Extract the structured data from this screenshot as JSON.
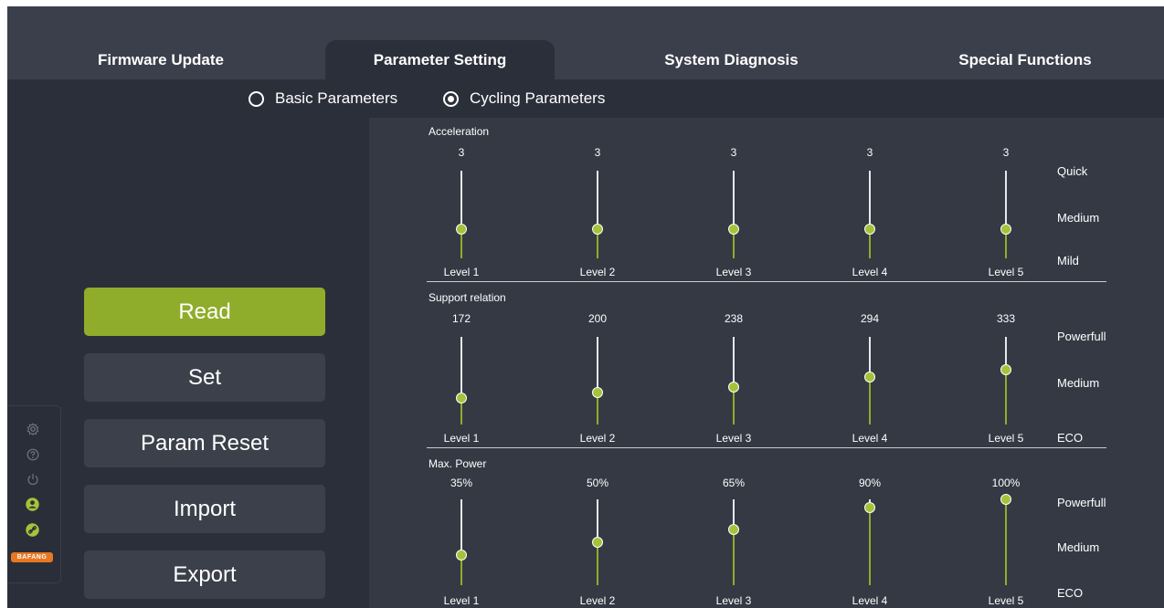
{
  "tabs": [
    {
      "label": "Firmware Update",
      "active": false
    },
    {
      "label": "Parameter Setting",
      "active": true
    },
    {
      "label": "System Diagnosis",
      "active": false
    },
    {
      "label": "Special Functions",
      "active": false
    }
  ],
  "radios": [
    {
      "label": "Basic Parameters",
      "checked": false
    },
    {
      "label": "Cycling Parameters",
      "checked": true
    }
  ],
  "buttons": {
    "read": "Read",
    "set": "Set",
    "param_reset": "Param Reset",
    "import": "Import",
    "export": "Export"
  },
  "sidebar_icons": [
    "gear-icon",
    "help-icon",
    "power-icon",
    "user-icon",
    "link-icon"
  ],
  "logo": {
    "text": "BAFANG"
  },
  "colors": {
    "accent": "#8fad2a",
    "thumb": "#a6c23a",
    "panel": "#2b2f39",
    "background": "#353944"
  },
  "sections": [
    {
      "title": "Acceleration",
      "sliders": [
        {
          "value": "3",
          "label": "Level 1",
          "level": 0.33
        },
        {
          "value": "3",
          "label": "Level 2",
          "level": 0.33
        },
        {
          "value": "3",
          "label": "Level 3",
          "level": 0.33
        },
        {
          "value": "3",
          "label": "Level 4",
          "level": 0.33
        },
        {
          "value": "3",
          "label": "Level 5",
          "level": 0.33
        }
      ],
      "scale": [
        "Quick",
        "Medium",
        "Mild"
      ]
    },
    {
      "title": "Support relation",
      "sliders": [
        {
          "value": "172",
          "label": "Level 1",
          "level": 0.3
        },
        {
          "value": "200",
          "label": "Level 2",
          "level": 0.36
        },
        {
          "value": "238",
          "label": "Level 3",
          "level": 0.43
        },
        {
          "value": "294",
          "label": "Level 4",
          "level": 0.54
        },
        {
          "value": "333",
          "label": "Level 5",
          "level": 0.62
        }
      ],
      "scale": [
        "Powerfull",
        "Medium",
        "ECO"
      ]
    },
    {
      "title": "Max. Power",
      "sliders": [
        {
          "value": "35%",
          "label": "Level 1",
          "level": 0.35
        },
        {
          "value": "50%",
          "label": "Level 2",
          "level": 0.5
        },
        {
          "value": "65%",
          "label": "Level 3",
          "level": 0.65
        },
        {
          "value": "90%",
          "label": "Level 4",
          "level": 0.9
        },
        {
          "value": "100%",
          "label": "Level 5",
          "level": 1.0
        }
      ],
      "scale": [
        "Powerfull",
        "Medium",
        "ECO"
      ]
    }
  ]
}
